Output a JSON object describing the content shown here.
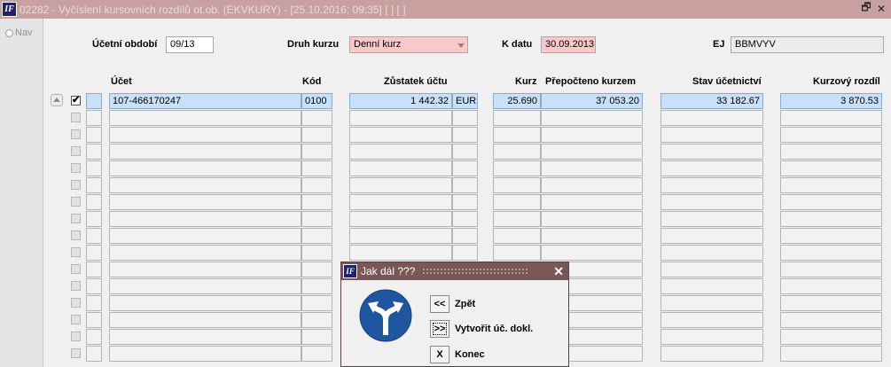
{
  "window": {
    "title": "02282 - Vyčíslení kursovních rozdílů ot.ob. (EKVKURY) - [25.10.2016; 09:35] [ ] [ ]",
    "app_icon": "IF",
    "restore_glyph": "🗗",
    "close_glyph": "✕"
  },
  "sidebar": {
    "nav_label": "Nav"
  },
  "filters": {
    "period_label": "Účetní období",
    "period_value": "09/13",
    "rate_type_label": "Druh kurzu",
    "rate_type_value": "Denní kurz",
    "date_label": "K datu",
    "date_value": "30.09.2013",
    "ej_label": "EJ",
    "ej_value": "BBMVYV"
  },
  "table": {
    "headers": {
      "account": "Účet",
      "code": "Kód",
      "balance": "Zůstatek účtu",
      "rate": "Kurz",
      "converted": "Přepočteno kurzem",
      "accounting": "Stav účetnictví",
      "difference": "Kurzový rozdíl"
    },
    "row0": {
      "checked": "✔",
      "account": "107-466170247",
      "code": "0100",
      "balance": "1 442.32",
      "currency": "EUR",
      "rate": "25.690",
      "converted": "37 053.20",
      "accounting": "33 182.67",
      "difference": "3 870.53"
    }
  },
  "dialog": {
    "title": "Jak dál ???",
    "close_glyph": "✕",
    "icon": "fork-arrow-sign-icon",
    "back_btn": "<<",
    "back_label": "Zpět",
    "create_btn": ">>",
    "create_label": "Vytvořit úč. dokl.",
    "exit_btn": "X",
    "exit_label": "Konec"
  },
  "colors": {
    "titlebar": "#c9a0a0",
    "dialog_title": "#7a5656",
    "required_field": "#f9c8c8",
    "selected_row": "#c8e0f8",
    "sign_blue": "#1e56a0"
  }
}
